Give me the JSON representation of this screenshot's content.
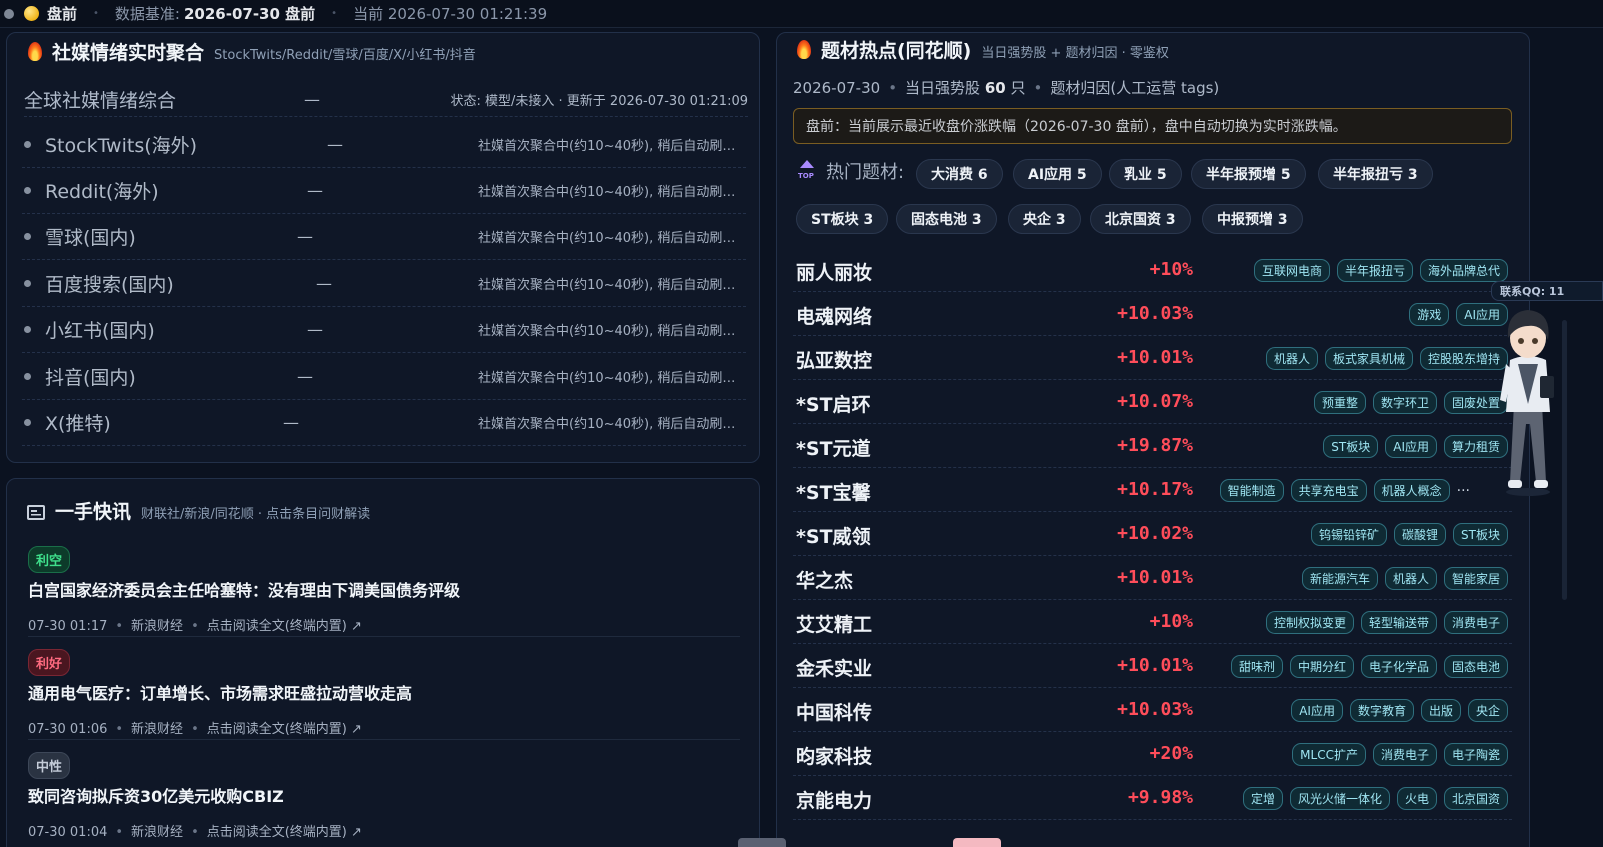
{
  "status_bar": {
    "phase": "盘前",
    "data_base_label": "数据基准:",
    "data_base_value": "2026-07-30 盘前",
    "current": "当前 2026-07-30 01:21:39"
  },
  "social": {
    "title": "社媒情绪实时聚合",
    "subtitle": "StockTwits/Reddit/雪球/百度/X/小红书/抖音",
    "summary": {
      "name": "全球社媒情绪综合",
      "value": "—",
      "status": "状态: 模型/未接入 · 更新于 2026-07-30 01:21:09"
    },
    "rows": [
      {
        "name": "StockTwits(海外)",
        "value": "—",
        "msg": "社媒首次聚合中(约10~40秒), 稍后自动刷新…"
      },
      {
        "name": "Reddit(海外)",
        "value": "—",
        "msg": "社媒首次聚合中(约10~40秒), 稍后自动刷新…"
      },
      {
        "name": "雪球(国内)",
        "value": "—",
        "msg": "社媒首次聚合中(约10~40秒), 稍后自动刷新…"
      },
      {
        "name": "百度搜索(国内)",
        "value": "—",
        "msg": "社媒首次聚合中(约10~40秒), 稍后自动刷新…"
      },
      {
        "name": "小红书(国内)",
        "value": "—",
        "msg": "社媒首次聚合中(约10~40秒), 稍后自动刷新…"
      },
      {
        "name": "抖音(国内)",
        "value": "—",
        "msg": "社媒首次聚合中(约10~40秒), 稍后自动刷新…"
      },
      {
        "name": "X(推特)",
        "value": "—",
        "msg": "社媒首次聚合中(约10~40秒), 稍后自动刷新…"
      }
    ]
  },
  "news": {
    "title": "一手快讯",
    "subtitle": "财联社/新浪/同花顺 · 点击条目问财解读",
    "items": [
      {
        "tag": "利空",
        "title": "白宫国家经济委员会主任哈塞特：没有理由下调美国债务评级",
        "time": "07-30 01:17",
        "source": "新浪财经",
        "link": "点击阅读全文(终端内置) ↗"
      },
      {
        "tag": "利好",
        "title": "通用电气医疗：订单增长、市场需求旺盛拉动营收走高",
        "time": "07-30 01:06",
        "source": "新浪财经",
        "link": "点击阅读全文(终端内置) ↗"
      },
      {
        "tag": "中性",
        "title": "致同咨询拟斥资30亿美元收购CBIZ",
        "time": "07-30 01:04",
        "source": "新浪财经",
        "link": "点击阅读全文(终端内置) ↗"
      }
    ]
  },
  "hot": {
    "title": "题材热点(同花顺)",
    "subtitle": "当日强势股 + 题材归因 · 零鉴权",
    "info_date": "2026-07-30",
    "info_strong_prefix": "当日强势股",
    "info_strong_count": "60",
    "info_strong_unit": "只",
    "info_attr": "题材归因(人工运营 tags)",
    "notice": "盘前：当前展示最近收盘价涨跌幅（2026-07-30 盘前），盘中自动切换为实时涨跌幅。",
    "topics_label": "热门题材:",
    "topics": [
      "大消费 6",
      "AI应用 5",
      "乳业 5",
      "半年报预增 5",
      "半年报扭亏 3",
      "ST板块 3",
      "固态电池 3",
      "央企 3",
      "北京国资 3",
      "中报预增 3"
    ],
    "stocks": [
      {
        "name": "丽人丽妆",
        "pct": "+10%",
        "tags": [
          "互联网电商",
          "半年报扭亏",
          "海外品牌总代"
        ]
      },
      {
        "name": "电魂网络",
        "pct": "+10.03%",
        "tags": [
          "游戏",
          "AI应用"
        ]
      },
      {
        "name": "弘亚数控",
        "pct": "+10.01%",
        "tags": [
          "机器人",
          "板式家具机械",
          "控股股东增持"
        ]
      },
      {
        "name": "*ST启环",
        "pct": "+10.07%",
        "tags": [
          "预重整",
          "数字环卫",
          "固废处置"
        ]
      },
      {
        "name": "*ST元道",
        "pct": "+19.87%",
        "tags": [
          "ST板块",
          "AI应用",
          "算力租赁"
        ]
      },
      {
        "name": "*ST宝馨",
        "pct": "+10.17%",
        "tags": [
          "智能制造",
          "共享充电宝",
          "机器人概念"
        ],
        "more": "···"
      },
      {
        "name": "*ST威领",
        "pct": "+10.02%",
        "tags": [
          "钨锡铅锌矿",
          "碳酸锂",
          "ST板块"
        ]
      },
      {
        "name": "华之杰",
        "pct": "+10.01%",
        "tags": [
          "新能源汽车",
          "机器人",
          "智能家居"
        ]
      },
      {
        "name": "艾艾精工",
        "pct": "+10%",
        "tags": [
          "控制权拟变更",
          "轻型输送带",
          "消费电子"
        ]
      },
      {
        "name": "金禾实业",
        "pct": "+10.01%",
        "tags": [
          "甜味剂",
          "中期分红",
          "电子化学品",
          "固态电池"
        ]
      },
      {
        "name": "中国科传",
        "pct": "+10.03%",
        "tags": [
          "AI应用",
          "数字教育",
          "出版",
          "央企"
        ]
      },
      {
        "name": "昀家科技",
        "pct": "+20%",
        "tags": [
          "MLCC扩产",
          "消费电子",
          "电子陶瓷"
        ]
      },
      {
        "name": "京能电力",
        "pct": "+9.98%",
        "tags": [
          "定增",
          "风光火储一体化",
          "火电",
          "北京国资"
        ]
      }
    ]
  },
  "widget": {
    "qq": "联系QQ: 11"
  },
  "colors": {
    "up": "#ff4d5a",
    "bg": "#0b1220",
    "panel": "#0f1727",
    "tag_text": "#9fe5f2",
    "warn_border": "#7a5d22"
  }
}
